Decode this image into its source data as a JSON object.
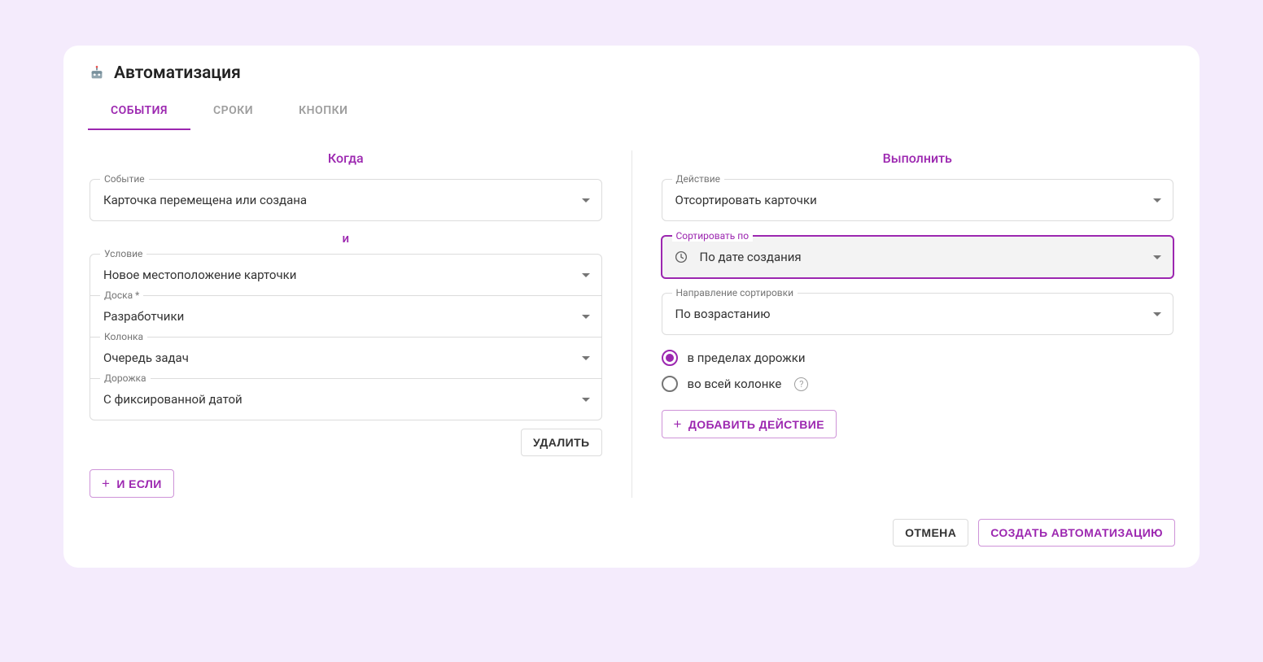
{
  "title": "Автоматизация",
  "tabs": {
    "events": "СОБЫТИЯ",
    "deadlines": "СРОКИ",
    "buttons": "КНОПКИ"
  },
  "when": {
    "heading": "Когда",
    "event_label": "Событие",
    "event_value": "Карточка перемещена или создана",
    "connector": "и",
    "condition_label": "Условие",
    "condition_value": "Новое местоположение карточки",
    "board_label": "Доска *",
    "board_value": "Разработчики",
    "column_label": "Колонка",
    "column_value": "Очередь задач",
    "lane_label": "Дорожка",
    "lane_value": "С фиксированной датой",
    "delete": "УДАЛИТЬ",
    "add_if": "И ЕСЛИ"
  },
  "do": {
    "heading": "Выполнить",
    "action_label": "Действие",
    "action_value": "Отсортировать карточки",
    "sortby_label": "Сортировать по",
    "sortby_value": "По дате создания",
    "direction_label": "Направление сортировки",
    "direction_value": "По возрастанию",
    "radio_lane": "в пределах дорожки",
    "radio_column": "во всей колонке",
    "add_action": "ДОБАВИТЬ ДЕЙСТВИЕ"
  },
  "footer": {
    "cancel": "ОТМЕНА",
    "create": "СОЗДАТЬ АВТОМАТИЗАЦИЮ"
  }
}
